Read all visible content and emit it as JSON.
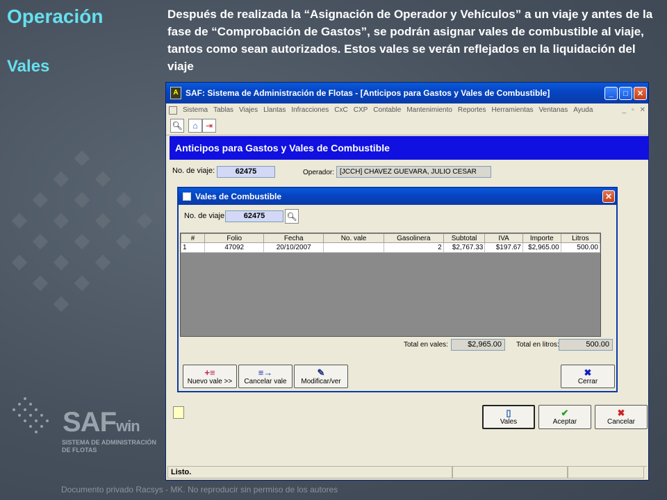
{
  "slide": {
    "title": "Operación",
    "subtitle": "Vales",
    "description": "Después de realizada la “Asignación de Operador y Vehículos” a un viaje y antes de la fase de “Comprobación de Gastos”, se podrán asignar vales de combustible al viaje, tantos como sean autorizados. Estos vales se verán reflejados en la liquidación del viaje",
    "footer": "Documento privado Racsys - MK. No reproducir sin permiso de los autores",
    "logo_main": "SAF",
    "logo_win": "win",
    "logo_sub": "SISTEMA DE ADMINISTRACIÓN DE FLOTAS"
  },
  "window": {
    "title": "SAF: Sistema de Administración de Flotas - [Anticipos para Gastos y Vales de Combustible]",
    "menu": [
      "Sistema",
      "Tablas",
      "Viajes",
      "Llantas",
      "Infracciones",
      "CxC",
      "CXP",
      "Contable",
      "Mantenimiento",
      "Reportes",
      "Herramientas",
      "Ventanas",
      "Ayuda"
    ],
    "header": "Anticipos para Gastos y Vales de Combustible",
    "viaje_label": "No. de viaje:",
    "viaje_value": "62475",
    "operador_label": "Operador:",
    "operador_value": "[JCCH] CHAVEZ GUEVARA, JULIO CESAR",
    "buttons": {
      "vales": "Vales",
      "aceptar": "Aceptar",
      "cancelar": "Cancelar"
    },
    "status": "Listo."
  },
  "dialog": {
    "title": "Vales de Combustible",
    "viaje_label": "No. de viaje:",
    "viaje_value": "62475",
    "columns": [
      "#",
      "Folio",
      "Fecha",
      "No. vale",
      "Gasolinera",
      "Subtotal",
      "IVA",
      "Importe",
      "Litros"
    ],
    "rows": [
      [
        "1",
        "47092",
        "20/10/2007",
        "",
        "2",
        "$2,767.33",
        "$197.67",
        "$2,965.00",
        "500.00"
      ]
    ],
    "total_vales_label": "Total en vales:",
    "total_vales_value": "$2,965.00",
    "total_litros_label": "Total en litros:",
    "total_litros_value": "500.00",
    "buttons": {
      "nuevo": "Nuevo vale >>",
      "cancelar": "Cancelar vale",
      "modificar": "Modificar/ver",
      "cerrar": "Cerrar"
    }
  },
  "colors": {
    "title_cyan": "#66e0ee",
    "header_blue": "#1010e0",
    "titlebar_blue": "#0646c4"
  }
}
